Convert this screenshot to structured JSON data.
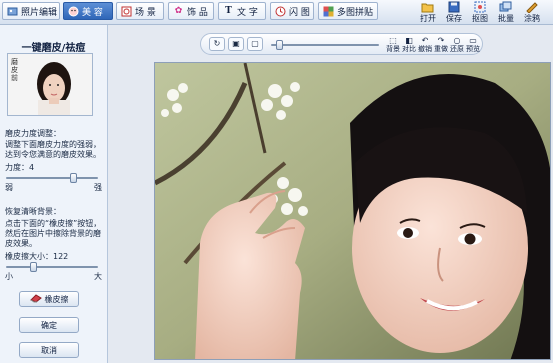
{
  "toolbar": {
    "tabs": [
      {
        "label": "照片编辑",
        "icon": "photo-edit-icon"
      },
      {
        "label": "美 容",
        "icon": "beauty-icon",
        "active": true
      },
      {
        "label": "场 景",
        "icon": "scene-icon"
      },
      {
        "label": "饰 品",
        "icon": "accessory-icon"
      },
      {
        "label": "文 字",
        "icon": "text-icon"
      },
      {
        "label": "闪 图",
        "icon": "flash-icon"
      },
      {
        "label": "多图拼贴",
        "icon": "collage-icon"
      }
    ],
    "actions": [
      {
        "label": "打开",
        "icon": "open-icon"
      },
      {
        "label": "保存",
        "icon": "save-icon"
      },
      {
        "label": "抠图",
        "icon": "cutout-icon"
      },
      {
        "label": "批量",
        "icon": "batch-icon"
      },
      {
        "label": "涂鸦",
        "icon": "doodle-icon"
      }
    ]
  },
  "panel": {
    "title": "一键磨皮/祛痘",
    "thumb_caption": "磨皮前",
    "strength_heading": "磨皮力度调整：",
    "strength_desc": "调整下面磨皮力度的强弱，达到令您满意的磨皮效果。",
    "strength_label": "力度：4",
    "strength_value": 4,
    "strength_fraction": 0.75,
    "strength_min_label": "弱",
    "strength_max_label": "强",
    "restore_heading": "恢复清晰背景：",
    "restore_desc": "点击下面的“橡皮擦”按钮，然后在图片中擦除背景的磨皮效果。",
    "eraser_size_label": "橡皮擦大小：122",
    "eraser_size_value": 122,
    "eraser_fraction": 0.28,
    "eraser_min_label": "小",
    "eraser_max_label": "大",
    "eraser_button": "橡皮擦",
    "ok_button": "确定",
    "cancel_button": "取消"
  },
  "view_toolbar": {
    "zoom_fraction": 0.05,
    "actions": [
      {
        "label": "背景",
        "icon": "background-icon"
      },
      {
        "label": "对比",
        "icon": "compare-icon"
      },
      {
        "label": "撤销",
        "icon": "undo-icon"
      },
      {
        "label": "重做",
        "icon": "redo-icon"
      },
      {
        "label": "还原",
        "icon": "restore-icon"
      },
      {
        "label": "预览",
        "icon": "preview-icon"
      }
    ]
  },
  "colors": {
    "accent": "#2f66b8",
    "panel_bg": "#eef3fa"
  }
}
